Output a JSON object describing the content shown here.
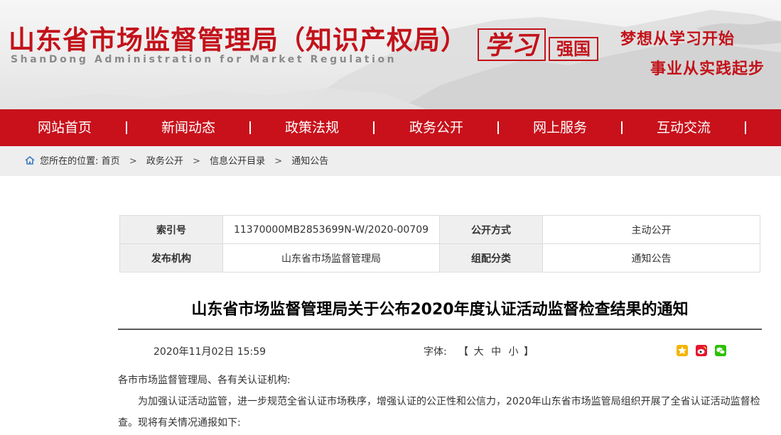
{
  "header": {
    "title": "山东省市场监督管理局（知识产权局）",
    "subtitle": "ShanDong Administration for Market Regulation",
    "logo_xuexi": "学习",
    "logo_qiangguo": "强国",
    "slogan_line1": "梦想从学习开始",
    "slogan_line2": "事业从实践起步"
  },
  "nav": {
    "items": [
      {
        "label": "网站首页"
      },
      {
        "label": "新闻动态"
      },
      {
        "label": "政策法规"
      },
      {
        "label": "政务公开"
      },
      {
        "label": "网上服务"
      },
      {
        "label": "互动交流"
      }
    ]
  },
  "breadcrumb": {
    "prefix": "您所在的位置:",
    "items": [
      "首页",
      "政务公开",
      "信息公开目录",
      "通知公告"
    ],
    "separator": ">"
  },
  "meta": {
    "index_label": "索引号",
    "index_value": "11370000MB2853699N-W/2020-00709",
    "disclosure_label": "公开方式",
    "disclosure_value": "主动公开",
    "publisher_label": "发布机构",
    "publisher_value": "山东省市场监督管理局",
    "category_label": "组配分类",
    "category_value": "通知公告"
  },
  "article": {
    "title": "山东省市场监督管理局关于公布2020年度认证活动监督检查结果的通知",
    "date": "2020年11月02日 15:59",
    "font_label": "字体:",
    "font_open": "【",
    "font_large": "大",
    "font_medium": "中",
    "font_small": "小",
    "font_close": "】",
    "salutation": "各市市场监督管理局、各有关认证机构:",
    "paragraph1": "为加强认证活动监管，进一步规范全省认证市场秩序，增强认证的公正性和公信力，2020年山东省市场监管局组织开展了全省认证活动监督检查。现将有关情况通报如下:"
  },
  "share": {
    "icons": [
      "qzone-icon",
      "weibo-icon",
      "wechat-icon"
    ],
    "colors": {
      "qzone": "#f5b400",
      "weibo": "#e6162d",
      "wechat": "#2dc100"
    }
  },
  "colors": {
    "brand_red": "#c8111b",
    "breadcrumb_bg": "#eeeeee",
    "label_bg": "#efefef"
  }
}
